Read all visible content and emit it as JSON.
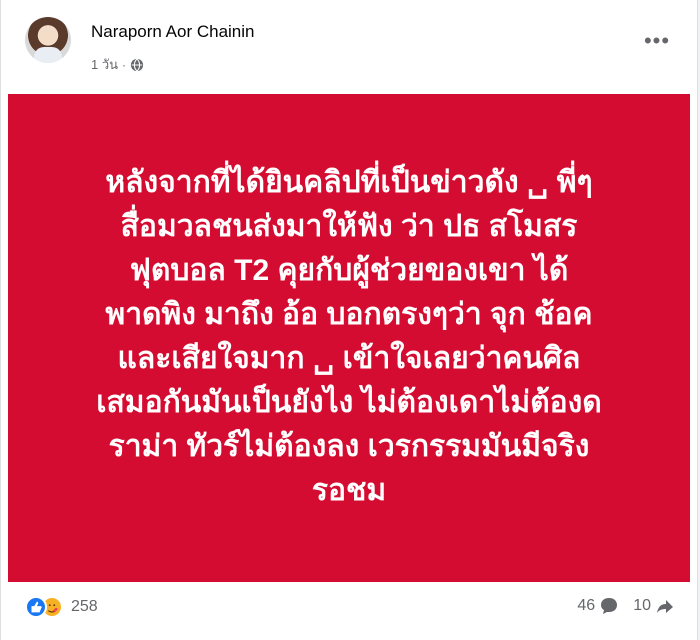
{
  "post": {
    "author": "Naraporn Aor Chainin",
    "time": "1 วัน",
    "audience_icon": "globe-icon",
    "more_icon": "more-horizontal-icon",
    "body_text": "หลังจากที่ได้ยินคลิปที่เป็นข่าวดัง ␣ พี่ๆ\nสื่อมวลชนส่งมาให้ฟัง ว่า ปธ สโมสร\nฟุตบอล T2 คุยกับผู้ช่วยของเขา ได้\nพาดพิง มาถึง อ้อ บอกตรงๆว่า จุก ช้อค\nและเสียใจมาก ␣ เข้าใจเลยว่าคนศิล\nเสมอกันมันเป็นยังไง ไม่ต้องเดาไม่ต้องด\nราม่า ทัวร์ไม่ต้องลง เวรกรรมมันมีจริง\nรอชม",
    "background_color": "#d50c31"
  },
  "footer": {
    "reactions_count": "258",
    "comments_count": "46",
    "shares_count": "10",
    "reaction_icons": [
      "like-icon",
      "care-icon"
    ],
    "comment_icon": "comment-icon",
    "share_icon": "share-icon"
  }
}
